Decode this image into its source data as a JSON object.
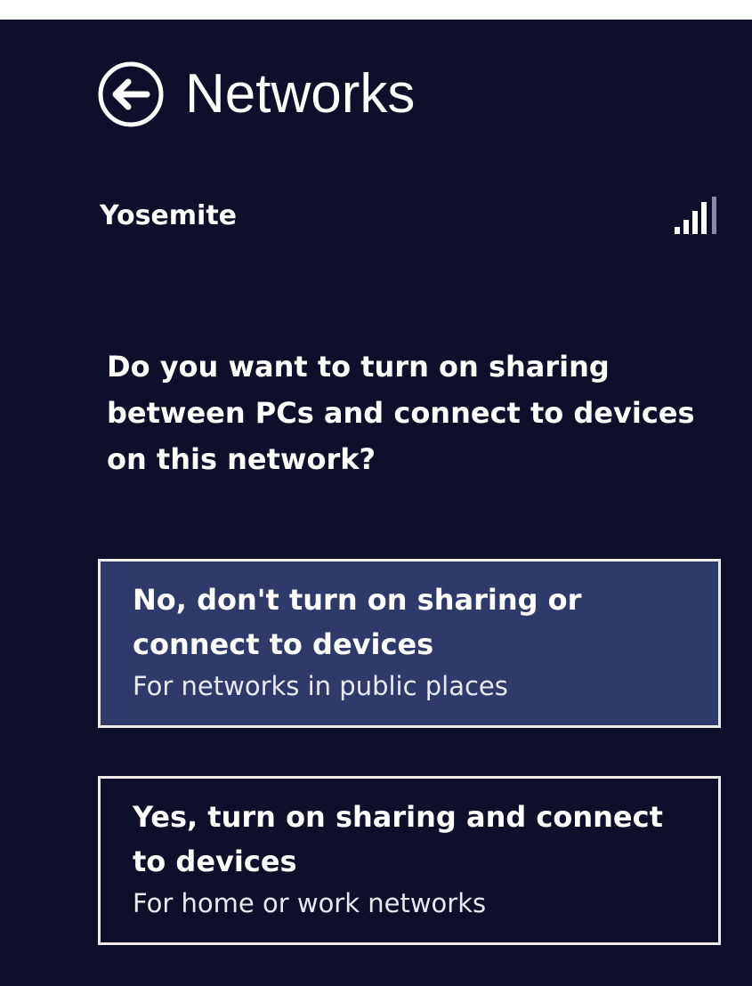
{
  "header": {
    "title": "Networks",
    "back_icon": "back-arrow-circle-icon"
  },
  "network": {
    "name": "Yosemite",
    "signal_icon": "wifi-signal-bars-icon",
    "signal_strength": 4
  },
  "prompt": {
    "question": "Do you want to turn on sharing between PCs and connect to devices on this network?"
  },
  "options": [
    {
      "title": "No, don't turn on sharing or connect to devices",
      "subtitle": "For networks in public places",
      "selected": true
    },
    {
      "title": "Yes, turn on sharing and connect to devices",
      "subtitle": "For home or work networks",
      "selected": false
    }
  ],
  "colors": {
    "panel_background": "#0d0f2b",
    "selected_option_background": "#2e3b6a",
    "border": "#f1ecec",
    "text": "#ffffff"
  }
}
